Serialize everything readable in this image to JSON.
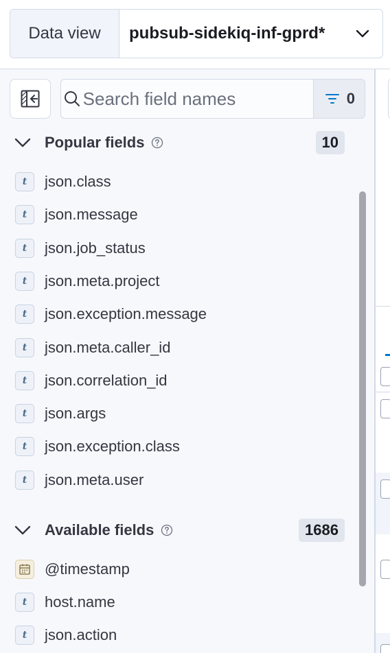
{
  "data_view": {
    "label": "Data view",
    "value": "pubsub-sidekiq-inf-gprd*"
  },
  "search": {
    "placeholder": "Search field names",
    "filter_count": "0"
  },
  "popular": {
    "title": "Popular fields",
    "count": "10",
    "fields": [
      {
        "name": "json.class",
        "type": "t"
      },
      {
        "name": "json.message",
        "type": "t"
      },
      {
        "name": "json.job_status",
        "type": "t"
      },
      {
        "name": "json.meta.project",
        "type": "t"
      },
      {
        "name": "json.exception.message",
        "type": "t"
      },
      {
        "name": "json.meta.caller_id",
        "type": "t"
      },
      {
        "name": "json.correlation_id",
        "type": "t"
      },
      {
        "name": "json.args",
        "type": "t"
      },
      {
        "name": "json.exception.class",
        "type": "t"
      },
      {
        "name": "json.meta.user",
        "type": "t"
      }
    ]
  },
  "available": {
    "title": "Available fields",
    "count": "1686",
    "fields": [
      {
        "name": "@timestamp",
        "type": "date"
      },
      {
        "name": "host.name",
        "type": "t"
      },
      {
        "name": "json.action",
        "type": "t"
      }
    ]
  },
  "colors": {
    "accent": "#0077cc",
    "badge": "#e0e5ee",
    "sidebar_bg": "#f7f8fc"
  }
}
